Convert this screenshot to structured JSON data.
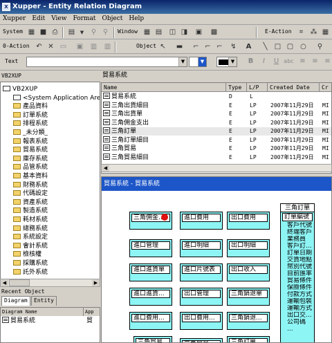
{
  "window": {
    "title": "Xupper - Entity Relation Diagram",
    "icon": "app-window-icon"
  },
  "menu": [
    "Xupper",
    "Edit",
    "View",
    "Format",
    "Object",
    "Help"
  ],
  "toolbar1": {
    "system_label": "System",
    "window_label": "Window",
    "eaction_label": "E-Action",
    "icons": [
      "grid-icon",
      "save-icon",
      "print-icon",
      "table-icon",
      "binoculars-icon",
      "binoculars-next-icon",
      "window-grid-icon",
      "window-list-icon",
      "window-tile-icon",
      "window-cascade-icon",
      "window-icon",
      "view-icon",
      "eaction-1-icon",
      "eaction-tree-icon",
      "eaction-grid-icon"
    ]
  },
  "toolbar2": {
    "oaction_label": "0-Action",
    "object_label": "Object",
    "icons": [
      "undo-icon",
      "delete-icon",
      "copy-icon",
      "paste-icon",
      "layout-icon",
      "pointer-icon",
      "entity-tool-icon",
      "relation-1-icon",
      "relation-2-icon",
      "relation-3-icon",
      "relation-4-icon",
      "text-tool-icon",
      "line-tool-icon",
      "rect-tool-icon",
      "round-rect-tool-icon",
      "ellipse-tool-icon",
      "zoom-icon"
    ]
  },
  "toolbar3": {
    "text_label": "Text",
    "font_value": "",
    "size_value": "",
    "format_icons": [
      "bold-icon",
      "italic-icon",
      "underline-icon",
      "strike-icon",
      "align-icon"
    ]
  },
  "left": {
    "header": "VB2XUP",
    "tree": [
      {
        "label": "VB2XUP",
        "level": 0,
        "icon": "project-icon"
      },
      {
        "label": "<System Application Area>",
        "level": 1,
        "icon": "system-icon"
      },
      {
        "label": "產品資料",
        "level": 1,
        "icon": "folder-icon"
      },
      {
        "label": "訂單系統",
        "level": 1,
        "icon": "folder-icon"
      },
      {
        "label": "排程系統",
        "level": 1,
        "icon": "folder-icon"
      },
      {
        "label": "_未分類_",
        "level": 1,
        "icon": "folder-icon"
      },
      {
        "label": "報表系統",
        "level": 1,
        "icon": "folder-icon"
      },
      {
        "label": "貿易系統",
        "level": 1,
        "icon": "folder-icon"
      },
      {
        "label": "庫存系統",
        "level": 1,
        "icon": "folder-icon"
      },
      {
        "label": "品管系統",
        "level": 1,
        "icon": "folder-icon"
      },
      {
        "label": "基本資料",
        "level": 1,
        "icon": "folder-icon"
      },
      {
        "label": "財務系統",
        "level": 1,
        "icon": "folder-icon"
      },
      {
        "label": "代碼設定",
        "level": 1,
        "icon": "folder-icon"
      },
      {
        "label": "資產系統",
        "level": 1,
        "icon": "folder-icon"
      },
      {
        "label": "製造系統",
        "level": 1,
        "icon": "folder-icon"
      },
      {
        "label": "耗材系統",
        "level": 1,
        "icon": "folder-icon"
      },
      {
        "label": "總務系統",
        "level": 1,
        "icon": "folder-icon"
      },
      {
        "label": "系統設定",
        "level": 1,
        "icon": "folder-icon"
      },
      {
        "label": "會計系統",
        "level": 1,
        "icon": "folder-icon"
      },
      {
        "label": "檢核權",
        "level": 1,
        "icon": "folder-icon"
      },
      {
        "label": "採購系統",
        "level": 1,
        "icon": "folder-icon"
      },
      {
        "label": "託外系統",
        "level": 1,
        "icon": "folder-icon"
      }
    ],
    "recent_label": "Recent Object",
    "tabs": [
      "Diagram",
      "Entity"
    ],
    "recent_columns": [
      "Diagram Name",
      "App"
    ],
    "recent_rows": [
      {
        "name": "貿易系統",
        "app": "貿"
      }
    ]
  },
  "grid": {
    "title": "貿易系統",
    "columns": [
      "Name",
      "Type",
      "L/P",
      "Created Date",
      "Cr"
    ],
    "rows": [
      {
        "name": "貿易系統",
        "type": "D",
        "lp": "L",
        "date": "",
        "cr": ""
      },
      {
        "name": "三角出貨細目",
        "type": "E",
        "lp": "LP",
        "date": "2007年11月29日",
        "cr": "MI"
      },
      {
        "name": "三角出貨單",
        "type": "E",
        "lp": "LP",
        "date": "2007年11月29日",
        "cr": "MI"
      },
      {
        "name": "三角佣金支出",
        "type": "E",
        "lp": "LP",
        "date": "2007年11月29日",
        "cr": "MI"
      },
      {
        "name": "三角訂單",
        "type": "E",
        "lp": "LP",
        "date": "2007年11月29日",
        "cr": "MI"
      },
      {
        "name": "三角訂單細目",
        "type": "E",
        "lp": "LP",
        "date": "2007年11月29日",
        "cr": "MI"
      },
      {
        "name": "三角貿易",
        "type": "E",
        "lp": "LP",
        "date": "2007年11月29日",
        "cr": "MI"
      },
      {
        "name": "三角貿易細目",
        "type": "E",
        "lp": "LP",
        "date": "2007年11月29日",
        "cr": "MI"
      }
    ]
  },
  "diagram": {
    "title": "貿易系統 - 貿易系統",
    "entities": [
      "三角佣金...",
      "進口費用",
      "出口費用",
      "進口管理",
      "進口明細",
      "出口明細",
      "進口進貨單",
      "進口片號表",
      "出口收入",
      "進口進貨...",
      "出口管理",
      "三角銷退單",
      "進口費用...",
      "出口費用...",
      "三角銷退...",
      "三角貿易...",
      "三角貿易",
      "三角訂單..."
    ],
    "big_entity": {
      "name": "三角訂單",
      "pk": "訂單編號",
      "attrs": [
        "客戶代號",
        "終端客戶",
        "業務員",
        "客戶訂...",
        "訂單日期",
        "交貨地點",
        "幣別代號",
        "目前匯率",
        "貿易條件",
        "保險條件",
        "付款方式",
        "運輸包裝",
        "運輸方式",
        "出口交...",
        "公司碼",
        "..."
      ]
    }
  }
}
